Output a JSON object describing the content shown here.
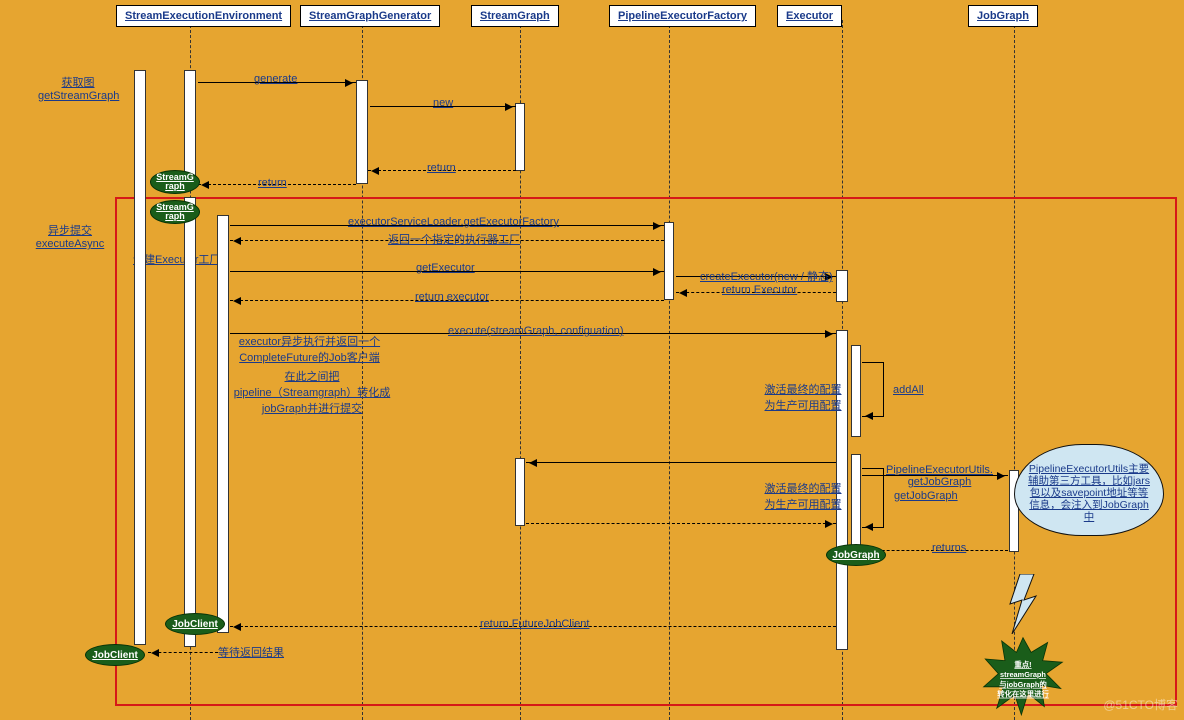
{
  "participants": {
    "p1": "StreamExecutionEnvironment",
    "p2": "StreamGraphGenerator",
    "p3": "StreamGraph",
    "p4": "PipelineExecutorFactory",
    "p5": "Executor",
    "p6": "JobGraph"
  },
  "phases": {
    "get_graph": "获取图",
    "get_graph2": "getStreamGraph",
    "async": "异步提交",
    "async2": "executeAsync",
    "create_factory": "创建Executor工厂"
  },
  "msgs": {
    "generate": "generate",
    "new": "new",
    "return1": "return",
    "return2": "return",
    "get_factory": "executorServiceLoader.getExecutorFactory",
    "return_factory": "返回一个指定的执行器工厂",
    "get_executor": "getExecutor",
    "create_executor": "createExecutor(new / 静态)",
    "return_executor_big": "return Executor",
    "return_executor": "return executor",
    "execute": "execute(streamGraph, configuation)",
    "exec_note_a": "executor异步执行并返回一个",
    "exec_note_b": "CompleteFuture的Job客户端",
    "mid_a": "在此之间把",
    "mid_b": "pipeline（Streamgraph）转化成",
    "mid_c": "jobGraph并进行提交",
    "activate1": "激活最终的配置",
    "activate1b": "为生产可用配置",
    "addAll": "addAll",
    "activate2": "激活最终的配置",
    "activate2b": "为生产可用配置",
    "peu_a": "PipelineExecutorUtils.",
    "peu_b": "getJobGraph",
    "get_job_graph": "getJobGraph",
    "returns": "returns",
    "return_future": "return FutureJobClient",
    "wait_result": "等待返回结果"
  },
  "ovals": {
    "sg1": "StreamG\nraph",
    "sg2": "StreamG\nraph",
    "jobclient1": "JobClient",
    "jobclient2": "JobClient",
    "jobgraph": "JobGraph"
  },
  "cloud": {
    "text": "PipelineExecutorUtils主要辅助第三方工具，比如jars包以及savepoint地址等等信息，会注入到JobGraph中"
  },
  "star": {
    "a": "重点!",
    "b": "streamGraph",
    "c": "与jobGraph的",
    "d": "转化在这里进行"
  },
  "watermark": "@51CTO博客"
}
